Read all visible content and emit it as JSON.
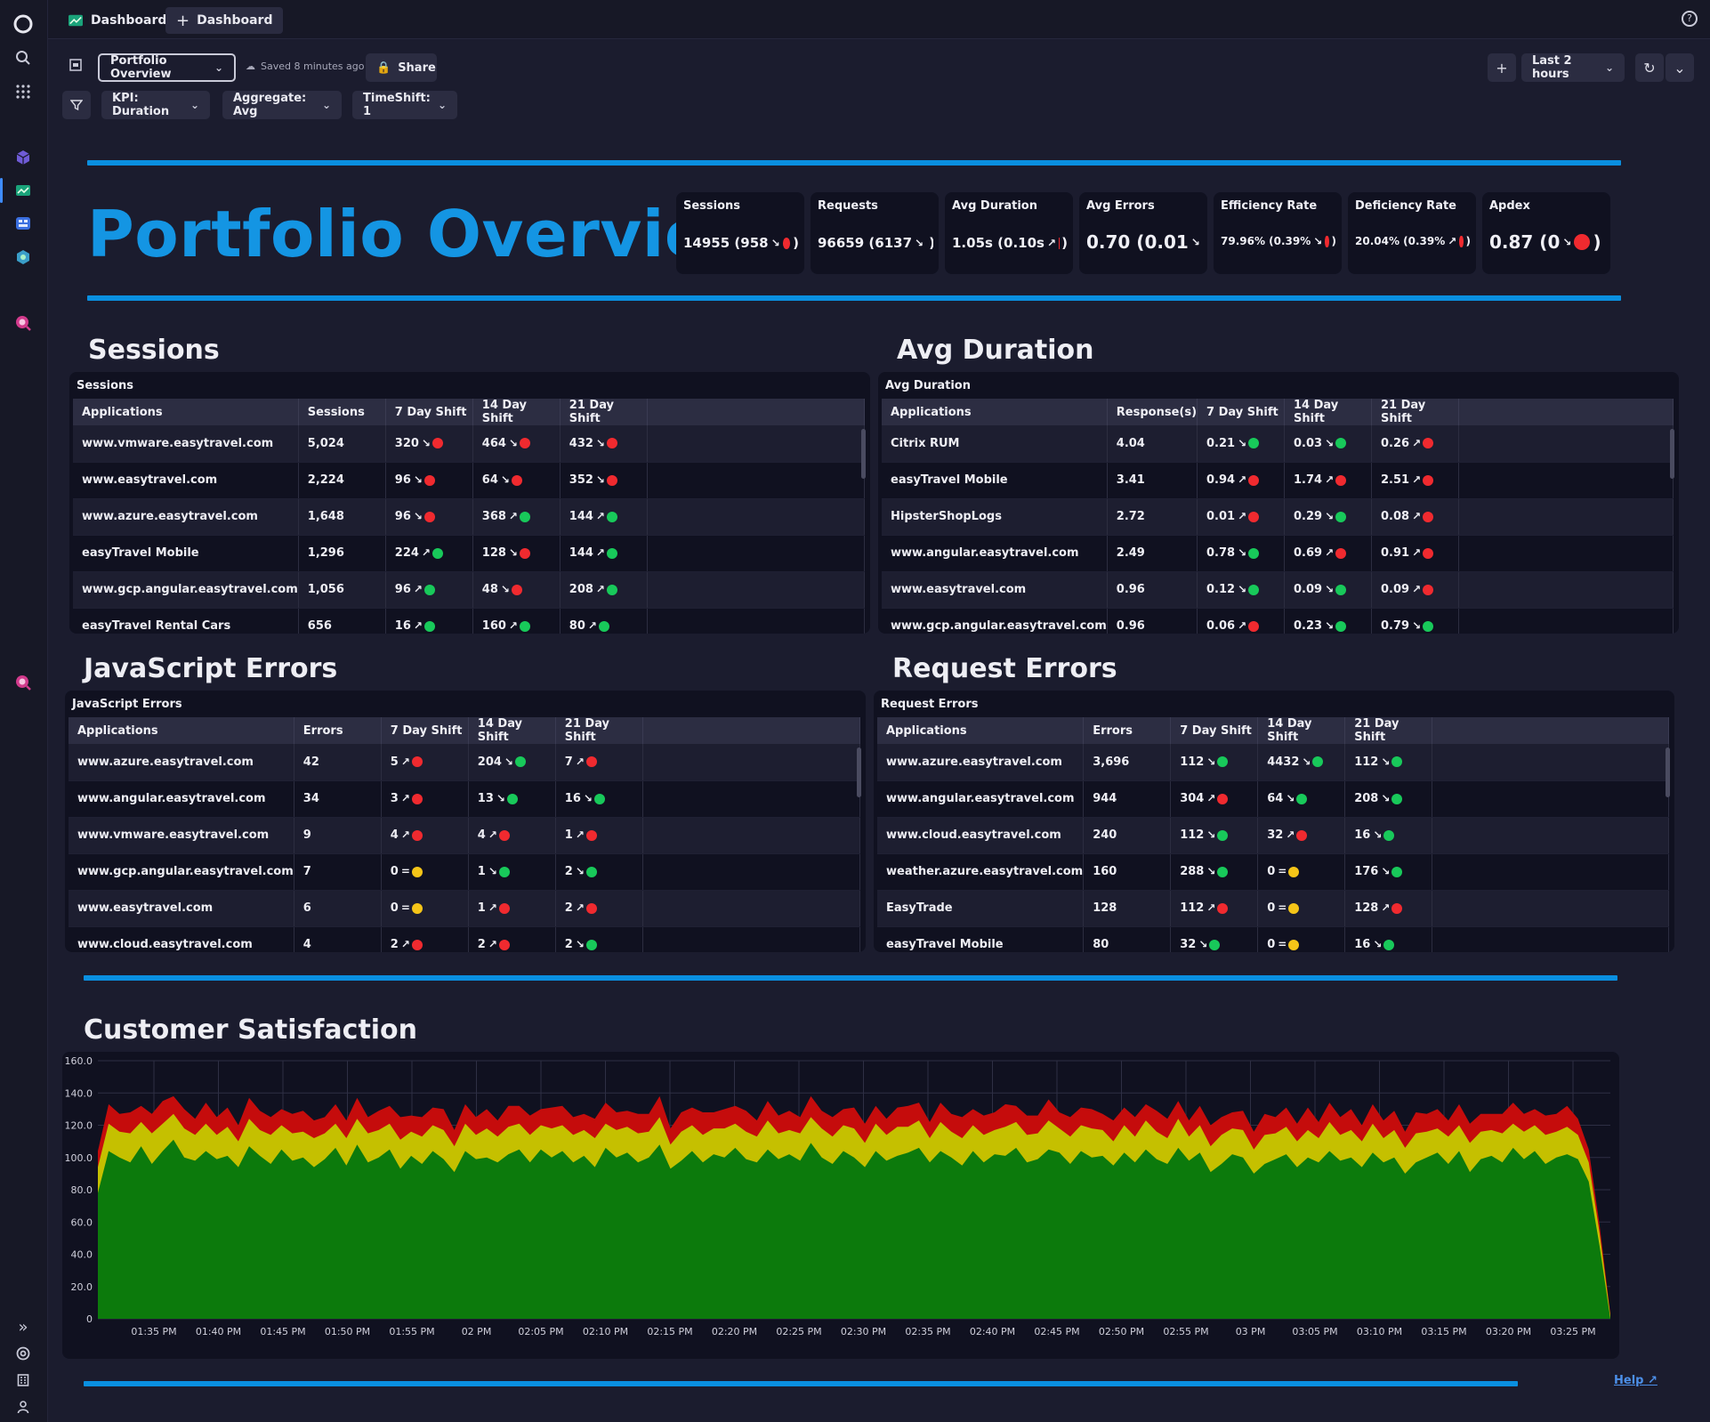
{
  "topbar": {
    "app_tab": "Dashboards",
    "add_tab": "Dashboard"
  },
  "toolbar": {
    "dashboard_select": "Portfolio Overview",
    "saved_text": "Saved 8 minutes ago",
    "share_label": "Share",
    "timeframe": "Last 2 hours",
    "filters": [
      "KPI: Duration",
      "Aggregate: Avg",
      "TimeShift: 1"
    ]
  },
  "header": {
    "title": "Portfolio Overview"
  },
  "kpis": [
    {
      "label": "Sessions",
      "value": "14955 (958",
      "arrow": "↘",
      "status": "red"
    },
    {
      "label": "Requests",
      "value": "96659 (6137",
      "arrow": "↘",
      "status": "red"
    },
    {
      "label": "Avg Duration",
      "value": "1.05s (0.10s",
      "arrow": "↗",
      "status": "red"
    },
    {
      "label": "Avg Errors",
      "value": "0.70 (0.01",
      "arrow": "↘",
      "status": "green"
    },
    {
      "label": "Efficiency Rate",
      "value": "79.96% (0.39%",
      "arrow": "↘",
      "status": "red"
    },
    {
      "label": "Deficiency Rate",
      "value": "20.04% (0.39%",
      "arrow": "↗",
      "status": "red"
    },
    {
      "label": "Apdex",
      "value": "0.87 (0",
      "arrow": "↘",
      "status": "red"
    }
  ],
  "sections": {
    "sessions": {
      "title": "Sessions",
      "tile_title": "Sessions",
      "columns": [
        "Applications",
        "Sessions",
        "7 Day Shift",
        "14 Day Shift",
        "21 Day Shift"
      ],
      "rows": [
        {
          "app": "www.vmware.easytravel.com",
          "v": "5,024",
          "s7": "320",
          "a7": "↘",
          "c7": "red",
          "s14": "464",
          "a14": "↘",
          "c14": "red",
          "s21": "432",
          "a21": "↘",
          "c21": "red"
        },
        {
          "app": "www.easytravel.com",
          "v": "2,224",
          "s7": "96",
          "a7": "↘",
          "c7": "red",
          "s14": "64",
          "a14": "↘",
          "c14": "red",
          "s21": "352",
          "a21": "↘",
          "c21": "red"
        },
        {
          "app": "www.azure.easytravel.com",
          "v": "1,648",
          "s7": "96",
          "a7": "↘",
          "c7": "red",
          "s14": "368",
          "a14": "↗",
          "c14": "green",
          "s21": "144",
          "a21": "↗",
          "c21": "green"
        },
        {
          "app": "easyTravel Mobile",
          "v": "1,296",
          "s7": "224",
          "a7": "↗",
          "c7": "green",
          "s14": "128",
          "a14": "↘",
          "c14": "red",
          "s21": "144",
          "a21": "↗",
          "c21": "green"
        },
        {
          "app": "www.gcp.angular.easytravel.com",
          "v": "1,056",
          "s7": "96",
          "a7": "↗",
          "c7": "green",
          "s14": "48",
          "a14": "↘",
          "c14": "red",
          "s21": "208",
          "a21": "↗",
          "c21": "green"
        },
        {
          "app": "easyTravel Rental Cars",
          "v": "656",
          "s7": "16",
          "a7": "↗",
          "c7": "green",
          "s14": "160",
          "a14": "↗",
          "c14": "green",
          "s21": "80",
          "a21": "↗",
          "c21": "green"
        }
      ]
    },
    "duration": {
      "title": "Avg Duration",
      "tile_title": "Avg Duration",
      "columns": [
        "Applications",
        "Response(s)",
        "7 Day Shift",
        "14 Day Shift",
        "21 Day Shift"
      ],
      "rows": [
        {
          "app": "Citrix RUM",
          "v": "4.04",
          "s7": "0.21",
          "a7": "↘",
          "c7": "green",
          "s14": "0.03",
          "a14": "↘",
          "c14": "green",
          "s21": "0.26",
          "a21": "↗",
          "c21": "red"
        },
        {
          "app": "easyTravel Mobile",
          "v": "3.41",
          "s7": "0.94",
          "a7": "↗",
          "c7": "red",
          "s14": "1.74",
          "a14": "↗",
          "c14": "red",
          "s21": "2.51",
          "a21": "↗",
          "c21": "red"
        },
        {
          "app": "HipsterShopLogs",
          "v": "2.72",
          "s7": "0.01",
          "a7": "↗",
          "c7": "red",
          "s14": "0.29",
          "a14": "↘",
          "c14": "green",
          "s21": "0.08",
          "a21": "↗",
          "c21": "red"
        },
        {
          "app": "www.angular.easytravel.com",
          "v": "2.49",
          "s7": "0.78",
          "a7": "↘",
          "c7": "green",
          "s14": "0.69",
          "a14": "↗",
          "c14": "red",
          "s21": "0.91",
          "a21": "↗",
          "c21": "red"
        },
        {
          "app": "www.easytravel.com",
          "v": "0.96",
          "s7": "0.12",
          "a7": "↘",
          "c7": "green",
          "s14": "0.09",
          "a14": "↘",
          "c14": "green",
          "s21": "0.09",
          "a21": "↗",
          "c21": "red"
        },
        {
          "app": "www.gcp.angular.easytravel.com",
          "v": "0.96",
          "s7": "0.06",
          "a7": "↗",
          "c7": "red",
          "s14": "0.23",
          "a14": "↘",
          "c14": "green",
          "s21": "0.79",
          "a21": "↘",
          "c21": "green"
        }
      ]
    },
    "jserrors": {
      "title": "JavaScript Errors",
      "tile_title": "JavaScript Errors",
      "columns": [
        "Applications",
        "Errors",
        "7 Day Shift",
        "14 Day Shift",
        "21 Day Shift"
      ],
      "rows": [
        {
          "app": "www.azure.easytravel.com",
          "v": "42",
          "s7": "5",
          "a7": "↗",
          "c7": "red",
          "s14": "204",
          "a14": "↘",
          "c14": "green",
          "s21": "7",
          "a21": "↗",
          "c21": "red"
        },
        {
          "app": "www.angular.easytravel.com",
          "v": "34",
          "s7": "3",
          "a7": "↗",
          "c7": "red",
          "s14": "13",
          "a14": "↘",
          "c14": "green",
          "s21": "16",
          "a21": "↘",
          "c21": "green"
        },
        {
          "app": "www.vmware.easytravel.com",
          "v": "9",
          "s7": "4",
          "a7": "↗",
          "c7": "red",
          "s14": "4",
          "a14": "↗",
          "c14": "red",
          "s21": "1",
          "a21": "↗",
          "c21": "red"
        },
        {
          "app": "www.gcp.angular.easytravel.com",
          "v": "7",
          "s7": "0",
          "a7": "=",
          "c7": "yellow",
          "s14": "1",
          "a14": "↘",
          "c14": "green",
          "s21": "2",
          "a21": "↘",
          "c21": "green"
        },
        {
          "app": "www.easytravel.com",
          "v": "6",
          "s7": "0",
          "a7": "=",
          "c7": "yellow",
          "s14": "1",
          "a14": "↗",
          "c14": "red",
          "s21": "2",
          "a21": "↗",
          "c21": "red"
        },
        {
          "app": "www.cloud.easytravel.com",
          "v": "4",
          "s7": "2",
          "a7": "↗",
          "c7": "red",
          "s14": "2",
          "a14": "↗",
          "c14": "red",
          "s21": "2",
          "a21": "↘",
          "c21": "green"
        }
      ]
    },
    "reqerrors": {
      "title": "Request Errors",
      "tile_title": "Request Errors",
      "columns": [
        "Applications",
        "Errors",
        "7 Day Shift",
        "14 Day Shift",
        "21 Day Shift"
      ],
      "rows": [
        {
          "app": "www.azure.easytravel.com",
          "v": "3,696",
          "s7": "112",
          "a7": "↘",
          "c7": "green",
          "s14": "4432",
          "a14": "↘",
          "c14": "green",
          "s21": "112",
          "a21": "↘",
          "c21": "green"
        },
        {
          "app": "www.angular.easytravel.com",
          "v": "944",
          "s7": "304",
          "a7": "↗",
          "c7": "red",
          "s14": "64",
          "a14": "↘",
          "c14": "green",
          "s21": "208",
          "a21": "↘",
          "c21": "green"
        },
        {
          "app": "www.cloud.easytravel.com",
          "v": "240",
          "s7": "112",
          "a7": "↘",
          "c7": "green",
          "s14": "32",
          "a14": "↗",
          "c14": "red",
          "s21": "16",
          "a21": "↘",
          "c21": "green"
        },
        {
          "app": "weather.azure.easytravel.com",
          "v": "160",
          "s7": "288",
          "a7": "↘",
          "c7": "green",
          "s14": "0",
          "a14": "=",
          "c14": "yellow",
          "s21": "176",
          "a21": "↘",
          "c21": "green"
        },
        {
          "app": "EasyTrade",
          "v": "128",
          "s7": "112",
          "a7": "↗",
          "c7": "red",
          "s14": "0",
          "a14": "=",
          "c14": "yellow",
          "s21": "128",
          "a21": "↗",
          "c21": "red"
        },
        {
          "app": "easyTravel Mobile",
          "v": "80",
          "s7": "32",
          "a7": "↘",
          "c7": "green",
          "s14": "0",
          "a14": "=",
          "c14": "yellow",
          "s21": "16",
          "a21": "↘",
          "c21": "green"
        }
      ]
    }
  },
  "satisfaction": {
    "title": "Customer Satisfaction"
  },
  "help": "Help",
  "colors": {
    "accent": "#0a8fe0",
    "red": "#f02a2f",
    "green": "#18c95a",
    "yellow": "#f5c518",
    "bg": "#1b1c2e",
    "tile": "#101120"
  },
  "chart_data": {
    "type": "area",
    "stacked": true,
    "ylim": [
      0,
      160
    ],
    "yticks": [
      "160.0",
      "140.0",
      "120.0",
      "100.0",
      "80.0",
      "60.0",
      "40.0",
      "20.0",
      "0"
    ],
    "xticks": [
      "01:35 PM",
      "01:40 PM",
      "01:45 PM",
      "01:50 PM",
      "01:55 PM",
      "02 PM",
      "02:05 PM",
      "02:10 PM",
      "02:15 PM",
      "02:20 PM",
      "02:25 PM",
      "02:30 PM",
      "02:35 PM",
      "02:40 PM",
      "02:45 PM",
      "02:50 PM",
      "02:55 PM",
      "03 PM",
      "03:05 PM",
      "03:10 PM",
      "03:15 PM",
      "03:20 PM",
      "03:25 PM"
    ],
    "series": [
      {
        "color": "#0c7a0c",
        "values": [
          78,
          104,
          100,
          97,
          107,
          96,
          104,
          111,
          100,
          98,
          104,
          99,
          101,
          94,
          107,
          101,
          96,
          105,
          98,
          100,
          94,
          99,
          106,
          95,
          108,
          97,
          100,
          105,
          93,
          101,
          96,
          104,
          99,
          91,
          104,
          99,
          100,
          97,
          102,
          105,
          97,
          105,
          100,
          104,
          97,
          101,
          94,
          106,
          100,
          103,
          97,
          100,
          108,
          93,
          98,
          104,
          97,
          102,
          100,
          106,
          99,
          97,
          105,
          99,
          102,
          98,
          109,
          100,
          96,
          104,
          100,
          94,
          104,
          98,
          101,
          103,
          106,
          97,
          104,
          100,
          95,
          104,
          97,
          102,
          101,
          106,
          97,
          99,
          105,
          103,
          96,
          104,
          100,
          101,
          95,
          103,
          97,
          105,
          99,
          96,
          106,
          98,
          103,
          91,
          96,
          102,
          100,
          90,
          96,
          99,
          102,
          94,
          100,
          97,
          104,
          98,
          100,
          94,
          103,
          97,
          100,
          90,
          97,
          100,
          103,
          96,
          104,
          91,
          99,
          101,
          97,
          106,
          99,
          104,
          96,
          100,
          102,
          99,
          85,
          45,
          0
        ]
      },
      {
        "color": "#c5c000",
        "values": [
          16,
          17,
          16,
          18,
          15,
          19,
          17,
          16,
          18,
          16,
          17,
          15,
          18,
          16,
          17,
          16,
          18,
          15,
          17,
          16,
          18,
          16,
          15,
          17,
          16,
          18,
          17,
          16,
          18,
          15,
          17,
          16,
          18,
          16,
          17,
          15,
          18,
          16,
          17,
          16,
          17,
          15,
          18,
          16,
          17,
          16,
          18,
          15,
          17,
          16,
          18,
          16,
          17,
          15,
          18,
          16,
          17,
          16,
          18,
          15,
          17,
          16,
          18,
          16,
          15,
          17,
          16,
          18,
          17,
          16,
          18,
          15,
          17,
          16,
          18,
          16,
          17,
          15,
          18,
          16,
          17,
          16,
          17,
          15,
          18,
          16,
          17,
          16,
          18,
          15,
          17,
          16,
          18,
          16,
          15,
          17,
          16,
          18,
          17,
          16,
          18,
          15,
          17,
          16,
          18,
          16,
          17,
          15,
          18,
          16,
          17,
          16,
          17,
          15,
          18,
          16,
          17,
          16,
          18,
          15,
          17,
          16,
          18,
          16,
          15,
          17,
          16,
          18,
          17,
          16,
          18,
          15,
          17,
          16,
          18,
          16,
          17,
          15,
          12,
          8,
          2
        ]
      },
      {
        "color": "#c50c0c",
        "values": [
          10,
          12,
          11,
          13,
          10,
          12,
          14,
          11,
          12,
          10,
          13,
          11,
          12,
          10,
          13,
          12,
          11,
          10,
          12,
          13,
          11,
          10,
          12,
          11,
          13,
          10,
          12,
          11,
          14,
          10,
          12,
          11,
          13,
          10,
          12,
          11,
          12,
          10,
          13,
          11,
          12,
          10,
          13,
          12,
          11,
          10,
          12,
          13,
          11,
          10,
          12,
          11,
          13,
          10,
          12,
          11,
          14,
          10,
          12,
          11,
          13,
          10,
          12,
          11,
          12,
          10,
          13,
          11,
          12,
          10,
          13,
          12,
          11,
          10,
          12,
          13,
          11,
          10,
          12,
          11,
          13,
          10,
          12,
          11,
          14,
          10,
          12,
          11,
          13,
          10,
          12,
          11,
          12,
          10,
          13,
          11,
          12,
          10,
          13,
          12,
          11,
          10,
          12,
          13,
          11,
          10,
          12,
          11,
          13,
          10,
          12,
          11,
          14,
          10,
          12,
          11,
          13,
          10,
          12,
          11,
          12,
          10,
          13,
          11,
          12,
          10,
          13,
          12,
          11,
          10,
          12,
          13,
          11,
          10,
          12,
          11,
          13,
          10,
          8,
          5,
          1
        ]
      }
    ]
  }
}
